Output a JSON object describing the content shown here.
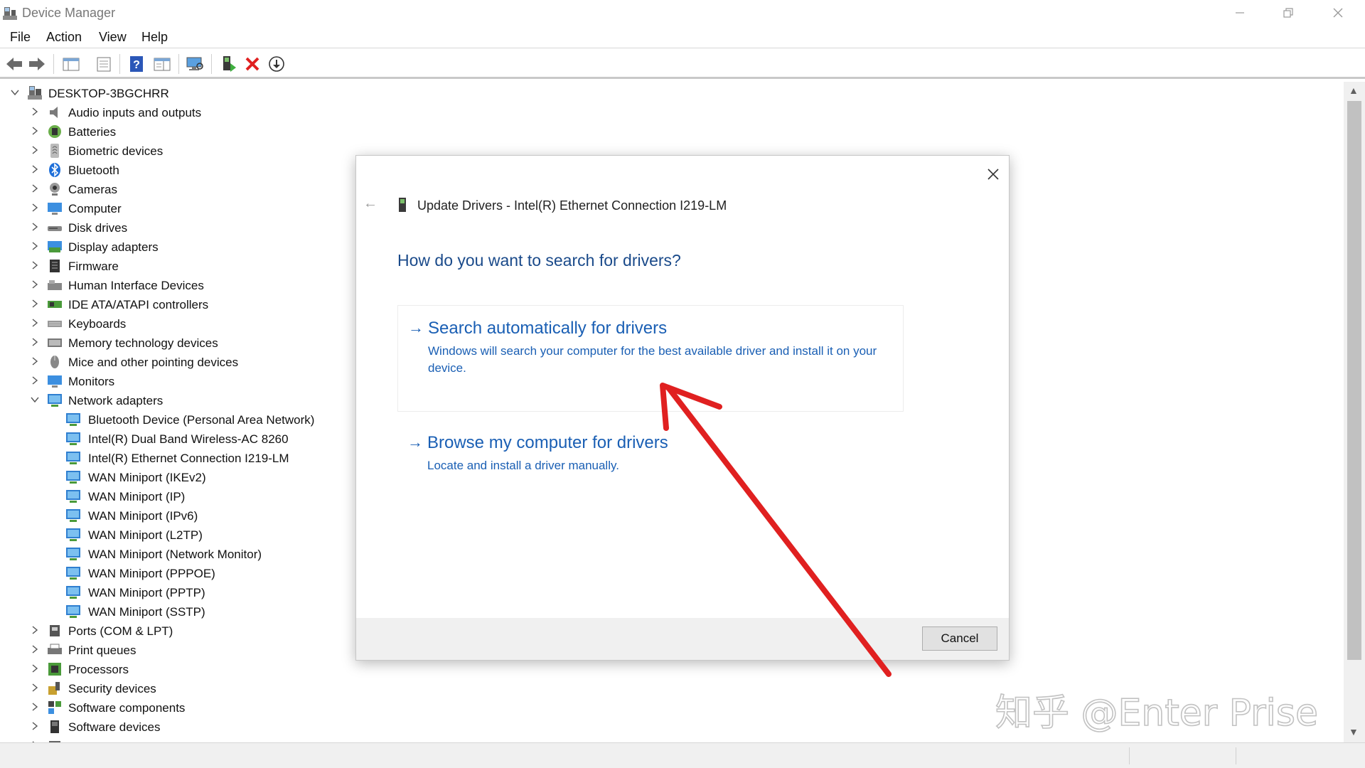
{
  "window": {
    "title": "Device Manager",
    "controls": [
      "minimize-icon",
      "restore-icon",
      "close-icon"
    ]
  },
  "menu": [
    "File",
    "Action",
    "View",
    "Help"
  ],
  "toolbar_icons": [
    "back-arrow-icon",
    "forward-arrow-icon",
    "show-hide-tree-icon",
    "properties-icon",
    "help-icon",
    "action-pane-icon",
    "scan-hardware-icon",
    "update-driver-icon",
    "uninstall-device-icon",
    "download-icon"
  ],
  "tree": {
    "root": "DESKTOP-3BGCHRR",
    "categories": [
      {
        "label": "Audio inputs and outputs",
        "icon": "speaker-icon"
      },
      {
        "label": "Batteries",
        "icon": "battery-icon"
      },
      {
        "label": "Biometric devices",
        "icon": "fingerprint-icon"
      },
      {
        "label": "Bluetooth",
        "icon": "bluetooth-icon"
      },
      {
        "label": "Cameras",
        "icon": "camera-icon"
      },
      {
        "label": "Computer",
        "icon": "computer-icon"
      },
      {
        "label": "Disk drives",
        "icon": "disk-drive-icon"
      },
      {
        "label": "Display adapters",
        "icon": "display-adapter-icon"
      },
      {
        "label": "Firmware",
        "icon": "firmware-icon"
      },
      {
        "label": "Human Interface Devices",
        "icon": "hid-icon"
      },
      {
        "label": "IDE ATA/ATAPI controllers",
        "icon": "ide-controller-icon"
      },
      {
        "label": "Keyboards",
        "icon": "keyboard-icon"
      },
      {
        "label": "Memory technology devices",
        "icon": "memory-icon"
      },
      {
        "label": "Mice and other pointing devices",
        "icon": "mouse-icon"
      },
      {
        "label": "Monitors",
        "icon": "monitor-icon"
      },
      {
        "label": "Network adapters",
        "icon": "network-adapter-icon",
        "expanded": true
      },
      {
        "label": "Ports (COM & LPT)",
        "icon": "port-icon"
      },
      {
        "label": "Print queues",
        "icon": "printer-icon"
      },
      {
        "label": "Processors",
        "icon": "processor-icon"
      },
      {
        "label": "Security devices",
        "icon": "security-icon"
      },
      {
        "label": "Software components",
        "icon": "software-component-icon"
      },
      {
        "label": "Software devices",
        "icon": "software-device-icon"
      },
      {
        "label": "",
        "icon": "sound-controller-icon"
      }
    ],
    "network_children": [
      "Bluetooth Device (Personal Area Network)",
      "Intel(R) Dual Band Wireless-AC 8260",
      "Intel(R) Ethernet Connection I219-LM",
      "WAN Miniport (IKEv2)",
      "WAN Miniport (IP)",
      "WAN Miniport (IPv6)",
      "WAN Miniport (L2TP)",
      "WAN Miniport (Network Monitor)",
      "WAN Miniport (PPPOE)",
      "WAN Miniport (PPTP)",
      "WAN Miniport (SSTP)"
    ]
  },
  "dialog": {
    "header": "Update Drivers - Intel(R) Ethernet Connection I219-LM",
    "question": "How do you want to search for drivers?",
    "option_auto": {
      "title": "Search automatically for drivers",
      "description": "Windows will search your computer for the best available driver and install it on your device."
    },
    "option_browse": {
      "title": "Browse my computer for drivers",
      "description": "Locate and install a driver manually."
    },
    "cancel_label": "Cancel"
  },
  "watermark": "知乎 @Enter Prise",
  "colors": {
    "link_blue": "#1a5fb4",
    "heading_blue": "#1a4a8a",
    "annotation_red": "#e02020",
    "network_icon_blue": "#2f7fd0"
  }
}
